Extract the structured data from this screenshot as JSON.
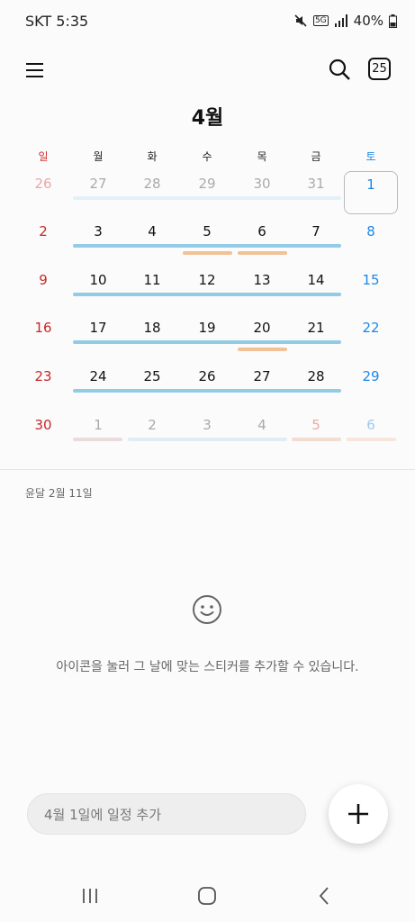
{
  "status_bar": {
    "carrier_time": "SKT 5:35",
    "network": "5G",
    "battery": "40%"
  },
  "header": {
    "today_badge": "25",
    "month_title": "4월"
  },
  "weekdays": [
    "일",
    "월",
    "화",
    "수",
    "목",
    "금",
    "토"
  ],
  "weeks": [
    [
      "26",
      "27",
      "28",
      "29",
      "30",
      "31",
      "1"
    ],
    [
      "2",
      "3",
      "4",
      "5",
      "6",
      "7",
      "8"
    ],
    [
      "9",
      "10",
      "11",
      "12",
      "13",
      "14",
      "15"
    ],
    [
      "16",
      "17",
      "18",
      "19",
      "20",
      "21",
      "22"
    ],
    [
      "23",
      "24",
      "25",
      "26",
      "27",
      "28",
      "29"
    ],
    [
      "30",
      "1",
      "2",
      "3",
      "4",
      "5",
      "6"
    ]
  ],
  "selected_date": "1",
  "lunar_date": "윤달 2월 11일",
  "sticker_hint": "아이콘을 눌러 그 날에 맞는 스티커를 추가할 수 있습니다.",
  "add_event_placeholder": "4월 1일에 일정 추가",
  "colors": {
    "event_blue": "#92cbe6",
    "event_orange": "#f2c196",
    "sunday": "#c62828",
    "saturday": "#1e88e5"
  }
}
